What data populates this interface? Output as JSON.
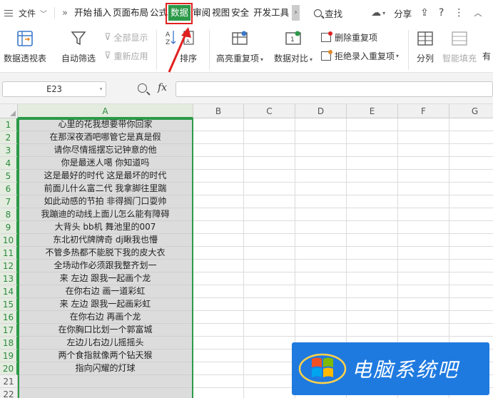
{
  "menubar": {
    "file_label": "文件",
    "more_glyph": "»",
    "tabs": [
      {
        "label": "开始"
      },
      {
        "label": "插入"
      },
      {
        "label": "页面布局"
      },
      {
        "label": "公式"
      },
      {
        "label": "数据"
      },
      {
        "label": "审阅"
      },
      {
        "label": "视图"
      },
      {
        "label": "安全"
      },
      {
        "label": "开发工具"
      }
    ],
    "active_tab": "数据",
    "search_label": "查找",
    "share_label": "分享"
  },
  "ribbon": {
    "pivot_label": "数据透视表",
    "filter_label": "自动筛选",
    "show_all_label": "全部显示",
    "reapply_label": "重新应用",
    "sort_label": "排序",
    "highlight_dup_label": "高亮重复项",
    "compare_label": "数据对比",
    "remove_dup_label": "删除重复项",
    "reject_dup_label": "拒绝录入重复项",
    "split_label": "分列",
    "smart_fill_label": "智能填充",
    "cut_off_label": "有"
  },
  "formula_bar": {
    "cell_ref": "E23",
    "fx_label": "fx",
    "formula": ""
  },
  "grid": {
    "columns": [
      "A",
      "B",
      "C",
      "D",
      "E",
      "F",
      "G"
    ],
    "selected_column": "A",
    "rows": [
      "心里的花我想要带你回家",
      "在那深夜酒吧哪管它是真是假",
      "请你尽情摇摆忘记钟意的他",
      "你是最迷人噶 你知道吗",
      "这是最好的时代 这是最坏的时代",
      "前面儿什么富二代 我拿脚往里踹",
      "如此动感的节拍 非得搁门口耍帅",
      "我蹦迪的动线上面儿怎么能有障碍",
      "大背头 bb机 舞池里的007",
      "东北初代牌牌奇 dj瞅我也懵",
      "不管多热都不能脱下我的皮大衣",
      "全场动作必须跟我整齐划一",
      "来 左边 跟我一起画个龙",
      "在你右边 画一道彩虹",
      "来 左边 跟我一起画彩虹",
      "在你右边 再画个龙",
      "在你胸口比划一个郭富城",
      "左边儿右边儿摇摇头",
      "两个食指就像两个钻天猴",
      "指向闪耀的灯球"
    ]
  },
  "watermark": {
    "text": "电脑系统吧"
  },
  "colors": {
    "accent_green": "#2b9a48",
    "annotation_red": "#e02020",
    "watermark_blue": "#1f7ae0"
  }
}
